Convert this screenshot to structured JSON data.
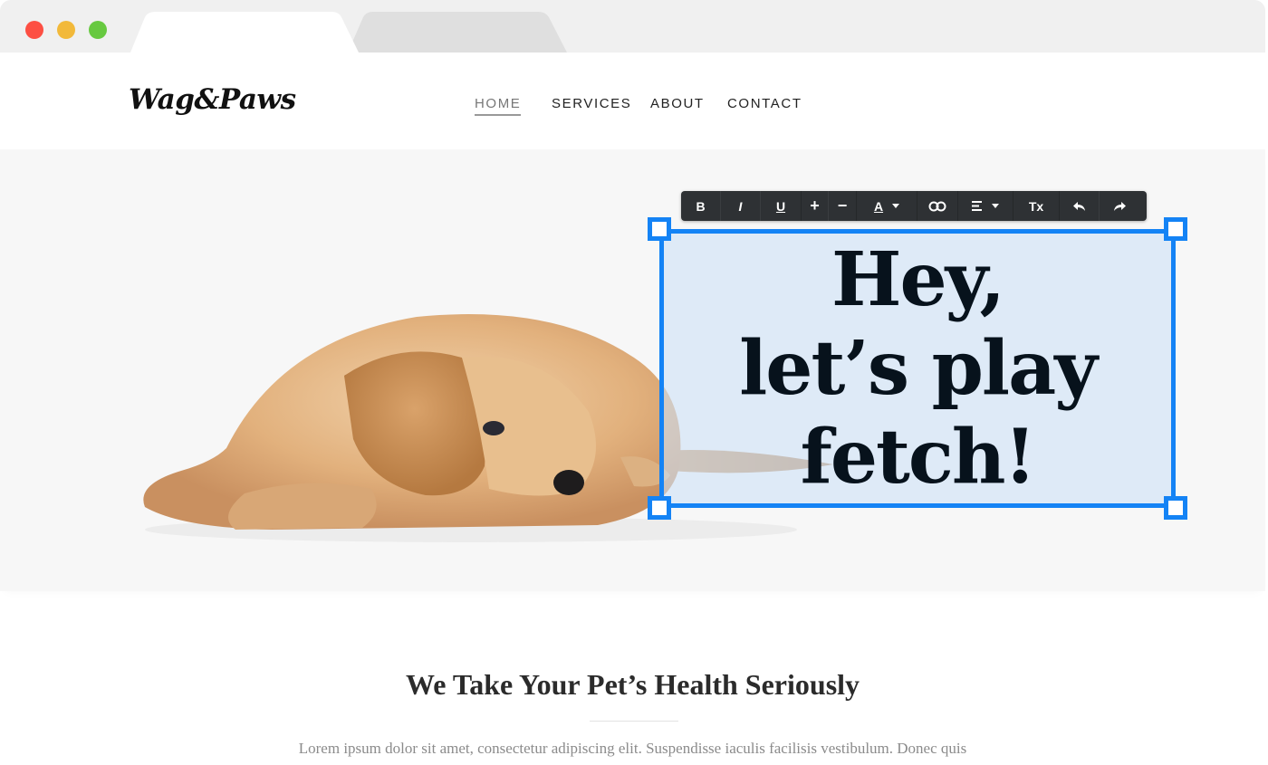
{
  "browser": {
    "window_controls": [
      "close",
      "minimize",
      "maximize"
    ],
    "tabs": [
      {
        "state": "active"
      },
      {
        "state": "inactive"
      }
    ]
  },
  "site": {
    "logo": "Wag&Paws",
    "nav": [
      {
        "label": "HOME",
        "active": true
      },
      {
        "label": "SERVICES",
        "active": false
      },
      {
        "label": "ABOUT",
        "active": false
      },
      {
        "label": "CONTACT",
        "active": false
      }
    ]
  },
  "hero": {
    "image": "golden-retriever-puppy-lying-down",
    "headline_lines": [
      "Hey,",
      "let’s play",
      "fetch!"
    ]
  },
  "editor_toolbar": {
    "buttons": [
      {
        "name": "bold",
        "label": "B"
      },
      {
        "name": "italic",
        "label": "I"
      },
      {
        "name": "underline",
        "label": "U"
      },
      {
        "name": "increase-size",
        "label": "+"
      },
      {
        "name": "decrease-size",
        "label": "−"
      },
      {
        "name": "text-color",
        "label": "A"
      },
      {
        "name": "link",
        "label": "link-icon"
      },
      {
        "name": "align",
        "label": "align-left-icon"
      },
      {
        "name": "clear-format",
        "label": "Tx"
      },
      {
        "name": "undo",
        "label": "undo-icon"
      },
      {
        "name": "redo",
        "label": "redo-icon"
      }
    ],
    "accent": "#1483f5"
  },
  "section": {
    "title": "We Take Your Pet’s Health Seriously",
    "text": "Lorem ipsum dolor sit amet, consectetur adipiscing elit. Suspendisse iaculis facilisis vestibulum. Donec quis"
  }
}
